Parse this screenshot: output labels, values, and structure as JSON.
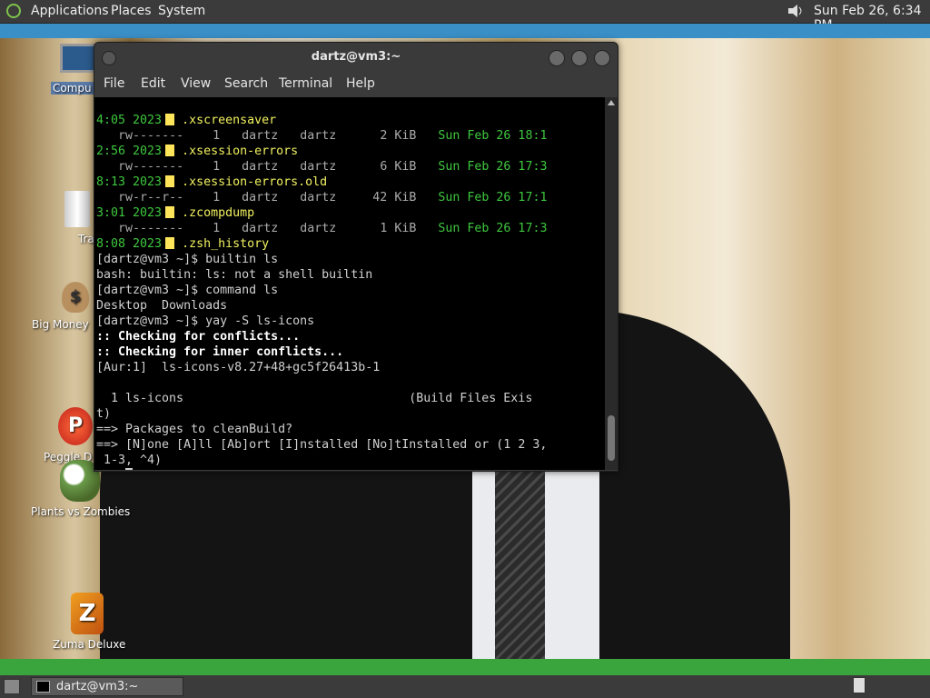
{
  "top_panel": {
    "menus": [
      "Applications",
      "Places",
      "System"
    ],
    "clock": "Sun Feb 26, 6:34 PM"
  },
  "desktop_icons": [
    {
      "label": "Compu",
      "icon": "computer-icon"
    },
    {
      "label": "Tras",
      "icon": "trash-icon"
    },
    {
      "label": "Big Money",
      "icon": "money-bag-icon"
    },
    {
      "label": "Peggle D",
      "icon": "peggle-icon"
    },
    {
      "label": "Plants vs Zombies",
      "icon": "plants-vs-zombies-icon"
    },
    {
      "label": "Zuma Deluxe",
      "icon": "zuma-icon"
    }
  ],
  "terminal": {
    "title": "dartz@vm3:~",
    "menu": [
      "File",
      "Edit",
      "View",
      "Search",
      "Terminal",
      "Help"
    ],
    "lines": [
      {
        "date": "4:05 2023",
        "name": ".xscreensaver"
      },
      {
        "perm": "rw-------",
        "n": "1",
        "user": "dartz",
        "group": "dartz",
        "size": "2 KiB",
        "mtime": "Sun Feb 26 18:1"
      },
      {
        "date": "2:56 2023",
        "name": ".xsession-errors"
      },
      {
        "perm": "rw-------",
        "n": "1",
        "user": "dartz",
        "group": "dartz",
        "size": "6 KiB",
        "mtime": "Sun Feb 26 17:3"
      },
      {
        "date": "8:13 2023",
        "name": ".xsession-errors.old"
      },
      {
        "perm": "rw-r--r--",
        "n": "1",
        "user": "dartz",
        "group": "dartz",
        "size": "42 KiB",
        "mtime": "Sun Feb 26 17:1"
      },
      {
        "date": "3:01 2023",
        "name": ".zcompdump"
      },
      {
        "perm": "rw-------",
        "n": "1",
        "user": "dartz",
        "group": "dartz",
        "size": "1 KiB",
        "mtime": "Sun Feb 26 17:3"
      },
      {
        "date": "8:08 2023",
        "name": ".zsh_history"
      }
    ],
    "output": [
      "[dartz@vm3 ~]$ builtin ls",
      "bash: builtin: ls: not a shell builtin",
      "[dartz@vm3 ~]$ command ls",
      "Desktop  Downloads",
      "[dartz@vm3 ~]$ yay -S ls-icons"
    ],
    "bold_lines": [
      ":: Checking for conflicts...",
      ":: Checking for inner conflicts..."
    ],
    "aur_line": "[Aur:1]  ls-icons-v8.27+48+gc5f26413b-1",
    "pkg_line": "  1 ls-icons                               (Build Files Exis",
    "pkg_wrap": "t)",
    "prompt1": "==> Packages to cleanBuild?",
    "prompt2": "==> [N]one [A]ll [Ab]ort [I]nstalled [No]tInstalled or (1 2 3,",
    "prompt2_wrap": " 1-3, ^4)",
    "prompt3": "==>"
  },
  "taskbar": {
    "window_button": "dartz@vm3:~"
  }
}
